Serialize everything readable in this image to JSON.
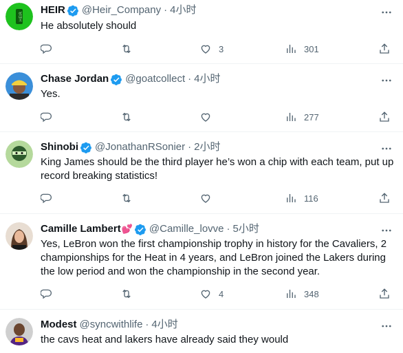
{
  "tweets": [
    {
      "name": "HEIR",
      "handle": "@Heir_Company",
      "time": "4小时",
      "text": "He absolutely should",
      "likes": "3",
      "views": "301",
      "avatar": "heir-logo"
    },
    {
      "name": "Chase Jordan",
      "handle": "@goatcollect",
      "time": "4小时",
      "text": "Yes.",
      "likes": "",
      "views": "277",
      "avatar": "man-in-cap"
    },
    {
      "name": "Shinobi",
      "handle": "@JonathanRSonier",
      "time": "2小时",
      "text": "King James should be the third player he’s won a chip with each team, put up record breaking statistics!",
      "likes": "",
      "views": "116",
      "avatar": "cartoon-ninja"
    },
    {
      "name": "Camille Lambert",
      "name_emoji": "💕",
      "handle": "@Camille_lovve",
      "time": "5小时",
      "text": "Yes, LeBron won the first championship trophy in history for the Cavaliers, 2 championships for the Heat in 4 years, and LeBron joined the Lakers during the low period and won the championship in the second year.",
      "likes": "4",
      "views": "348",
      "avatar": "woman-portrait"
    },
    {
      "name": "Modest",
      "handle": "@syncwithlife",
      "time": "4小时",
      "text": "the cavs heat and lakers have already said they would",
      "avatar": "lakers-player"
    }
  ],
  "separator": "·",
  "colors": {
    "verified": "#1d9bf0",
    "secondary_text": "#536471",
    "divider": "#eff3f4"
  }
}
